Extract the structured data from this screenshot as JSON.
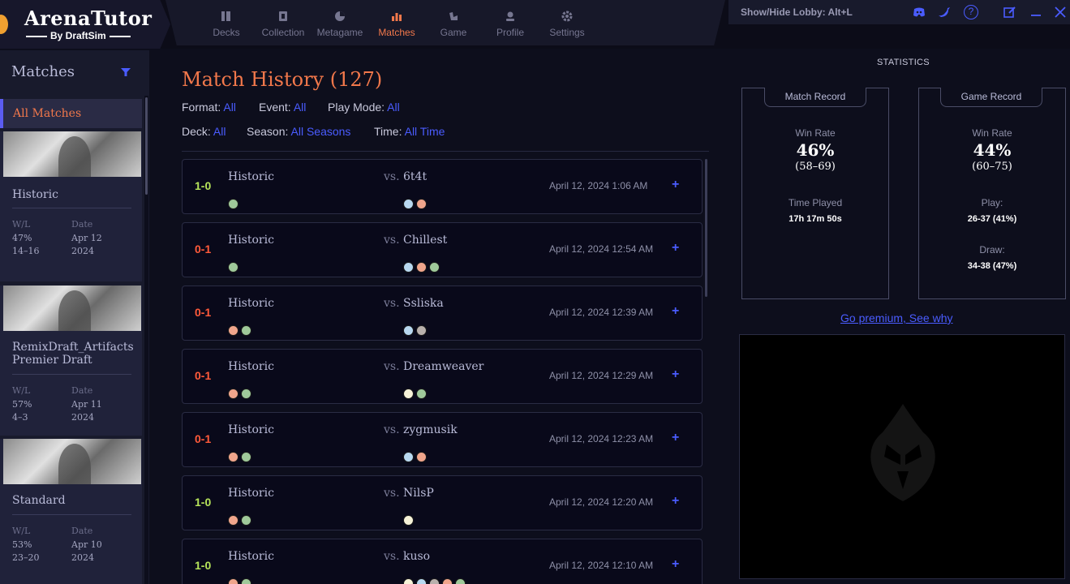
{
  "brand": {
    "name": "ArenaTutor",
    "byline": "By DraftSim"
  },
  "nav": [
    {
      "label": "Decks",
      "icon": "decks-icon"
    },
    {
      "label": "Collection",
      "icon": "collection-icon"
    },
    {
      "label": "Metagame",
      "icon": "metagame-icon"
    },
    {
      "label": "Matches",
      "icon": "matches-icon",
      "active": true
    },
    {
      "label": "Game",
      "icon": "game-icon"
    },
    {
      "label": "Profile",
      "icon": "profile-icon"
    },
    {
      "label": "Settings",
      "icon": "settings-icon"
    }
  ],
  "titlebar": {
    "lobby_hint": "Show/Hide Lobby: Alt+L",
    "icons": [
      "discord-icon",
      "twitter-icon",
      "help-icon",
      "edit-icon",
      "minimize-icon",
      "close-icon"
    ],
    "help_glyph": "?"
  },
  "sidebar": {
    "title": "Matches",
    "all_label": "All Matches",
    "wl_label": "W/L",
    "date_label": "Date",
    "cards": [
      {
        "name": "Historic",
        "wl_pct": "47%",
        "wl_rec": "14–16",
        "date_md": "Apr 12",
        "date_y": "2024"
      },
      {
        "name": "RemixDraft_Artifacts Premier Draft",
        "wl_pct": "57%",
        "wl_rec": "4–3",
        "date_md": "Apr 11",
        "date_y": "2024"
      },
      {
        "name": "Standard",
        "wl_pct": "53%",
        "wl_rec": "23–20",
        "date_md": "Apr 10",
        "date_y": "2024"
      }
    ]
  },
  "main": {
    "title": "Match History (127)",
    "filters": [
      {
        "label": "Format:",
        "value": "All"
      },
      {
        "label": "Event:",
        "value": "All"
      },
      {
        "label": "Play Mode:",
        "value": "All"
      },
      {
        "label": "Deck:",
        "value": "All"
      },
      {
        "label": "Season:",
        "value": "All Seasons"
      },
      {
        "label": "Time:",
        "value": "All Time"
      }
    ],
    "vs_label": "vs.",
    "expand_glyph": "+",
    "matches": [
      {
        "result": "1-0",
        "win": true,
        "format": "Historic",
        "my_colors": [
          "g"
        ],
        "opponent": "6t4t",
        "opp_colors": [
          "u",
          "r"
        ],
        "date": "April 12, 2024 1:06 AM"
      },
      {
        "result": "0-1",
        "win": false,
        "format": "Historic",
        "my_colors": [
          "g"
        ],
        "opponent": "Chillest",
        "opp_colors": [
          "u",
          "r",
          "g"
        ],
        "date": "April 12, 2024 12:54 AM"
      },
      {
        "result": "0-1",
        "win": false,
        "format": "Historic",
        "my_colors": [
          "r",
          "g"
        ],
        "opponent": "Ssliska",
        "opp_colors": [
          "u",
          "b"
        ],
        "date": "April 12, 2024 12:39 AM"
      },
      {
        "result": "0-1",
        "win": false,
        "format": "Historic",
        "my_colors": [
          "r",
          "g"
        ],
        "opponent": "Dreamweaver",
        "opp_colors": [
          "w",
          "g"
        ],
        "date": "April 12, 2024 12:29 AM"
      },
      {
        "result": "0-1",
        "win": false,
        "format": "Historic",
        "my_colors": [
          "r",
          "g"
        ],
        "opponent": "zygmusik",
        "opp_colors": [
          "u",
          "r"
        ],
        "date": "April 12, 2024 12:23 AM"
      },
      {
        "result": "1-0",
        "win": true,
        "format": "Historic",
        "my_colors": [
          "r",
          "g"
        ],
        "opponent": "NilsP",
        "opp_colors": [
          "w"
        ],
        "date": "April 12, 2024 12:20 AM"
      },
      {
        "result": "1-0",
        "win": true,
        "format": "Historic",
        "my_colors": [
          "r",
          "g"
        ],
        "opponent": "kuso",
        "opp_colors": [
          "w",
          "u",
          "b",
          "r",
          "g"
        ],
        "date": "April 12, 2024 12:10 AM"
      }
    ]
  },
  "stats": {
    "title": "STATISTICS",
    "match_record": {
      "tab": "Match Record",
      "win_rate_label": "Win Rate",
      "win_rate": "46%",
      "record": "(58–69)",
      "time_label": "Time Played",
      "time": "17h 17m 50s"
    },
    "game_record": {
      "tab": "Game Record",
      "win_rate_label": "Win Rate",
      "win_rate": "44%",
      "record": "(60–75)",
      "play_label": "Play:",
      "play": "26-37 (41%)",
      "draw_label": "Draw:",
      "draw": "34-38 (47%)"
    },
    "premium_link": "Go premium, See why"
  },
  "colors": {
    "accent": "#f2784b",
    "link": "#4a5cff",
    "win": "#b6e35a",
    "loss": "#ff5a3a"
  }
}
